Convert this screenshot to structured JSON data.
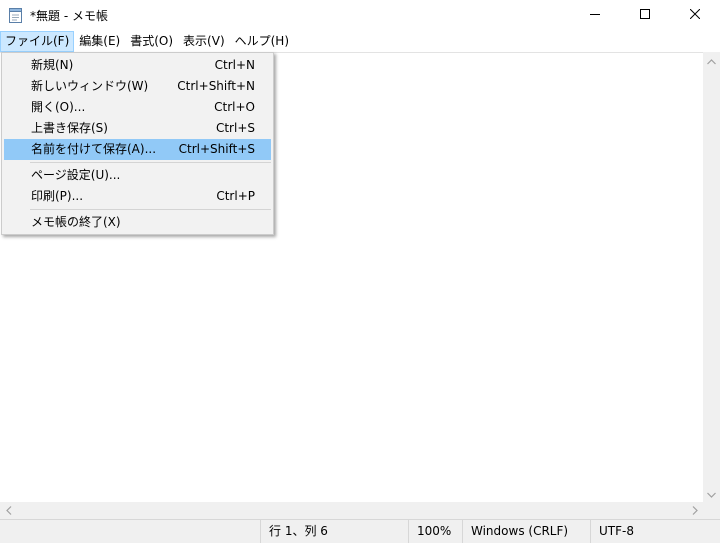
{
  "window": {
    "title": "*無題 - メモ帳",
    "icon": "notepad-icon"
  },
  "menubar": {
    "items": [
      {
        "label": "ファイル(F)",
        "active": true
      },
      {
        "label": "編集(E)"
      },
      {
        "label": "書式(O)"
      },
      {
        "label": "表示(V)"
      },
      {
        "label": "ヘルプ(H)"
      }
    ]
  },
  "file_menu": {
    "groups": [
      [
        {
          "label": "新規(N)",
          "shortcut": "Ctrl+N"
        },
        {
          "label": "新しいウィンドウ(W)",
          "shortcut": "Ctrl+Shift+N"
        },
        {
          "label": "開く(O)...",
          "shortcut": "Ctrl+O"
        },
        {
          "label": "上書き保存(S)",
          "shortcut": "Ctrl+S"
        },
        {
          "label": "名前を付けて保存(A)...",
          "shortcut": "Ctrl+Shift+S",
          "highlighted": true
        }
      ],
      [
        {
          "label": "ページ設定(U)...",
          "shortcut": ""
        },
        {
          "label": "印刷(P)...",
          "shortcut": "Ctrl+P"
        }
      ],
      [
        {
          "label": "メモ帳の終了(X)",
          "shortcut": ""
        }
      ]
    ]
  },
  "statusbar": {
    "position": "行 1、列 6",
    "zoom": "100%",
    "line_ending": "Windows (CRLF)",
    "encoding": "UTF-8"
  },
  "colors": {
    "menu_active_bg": "#cce8ff",
    "menu_highlight_bg": "#91c9f7",
    "dropdown_bg": "#f2f2f2",
    "statusbar_bg": "#f0f0f0"
  }
}
